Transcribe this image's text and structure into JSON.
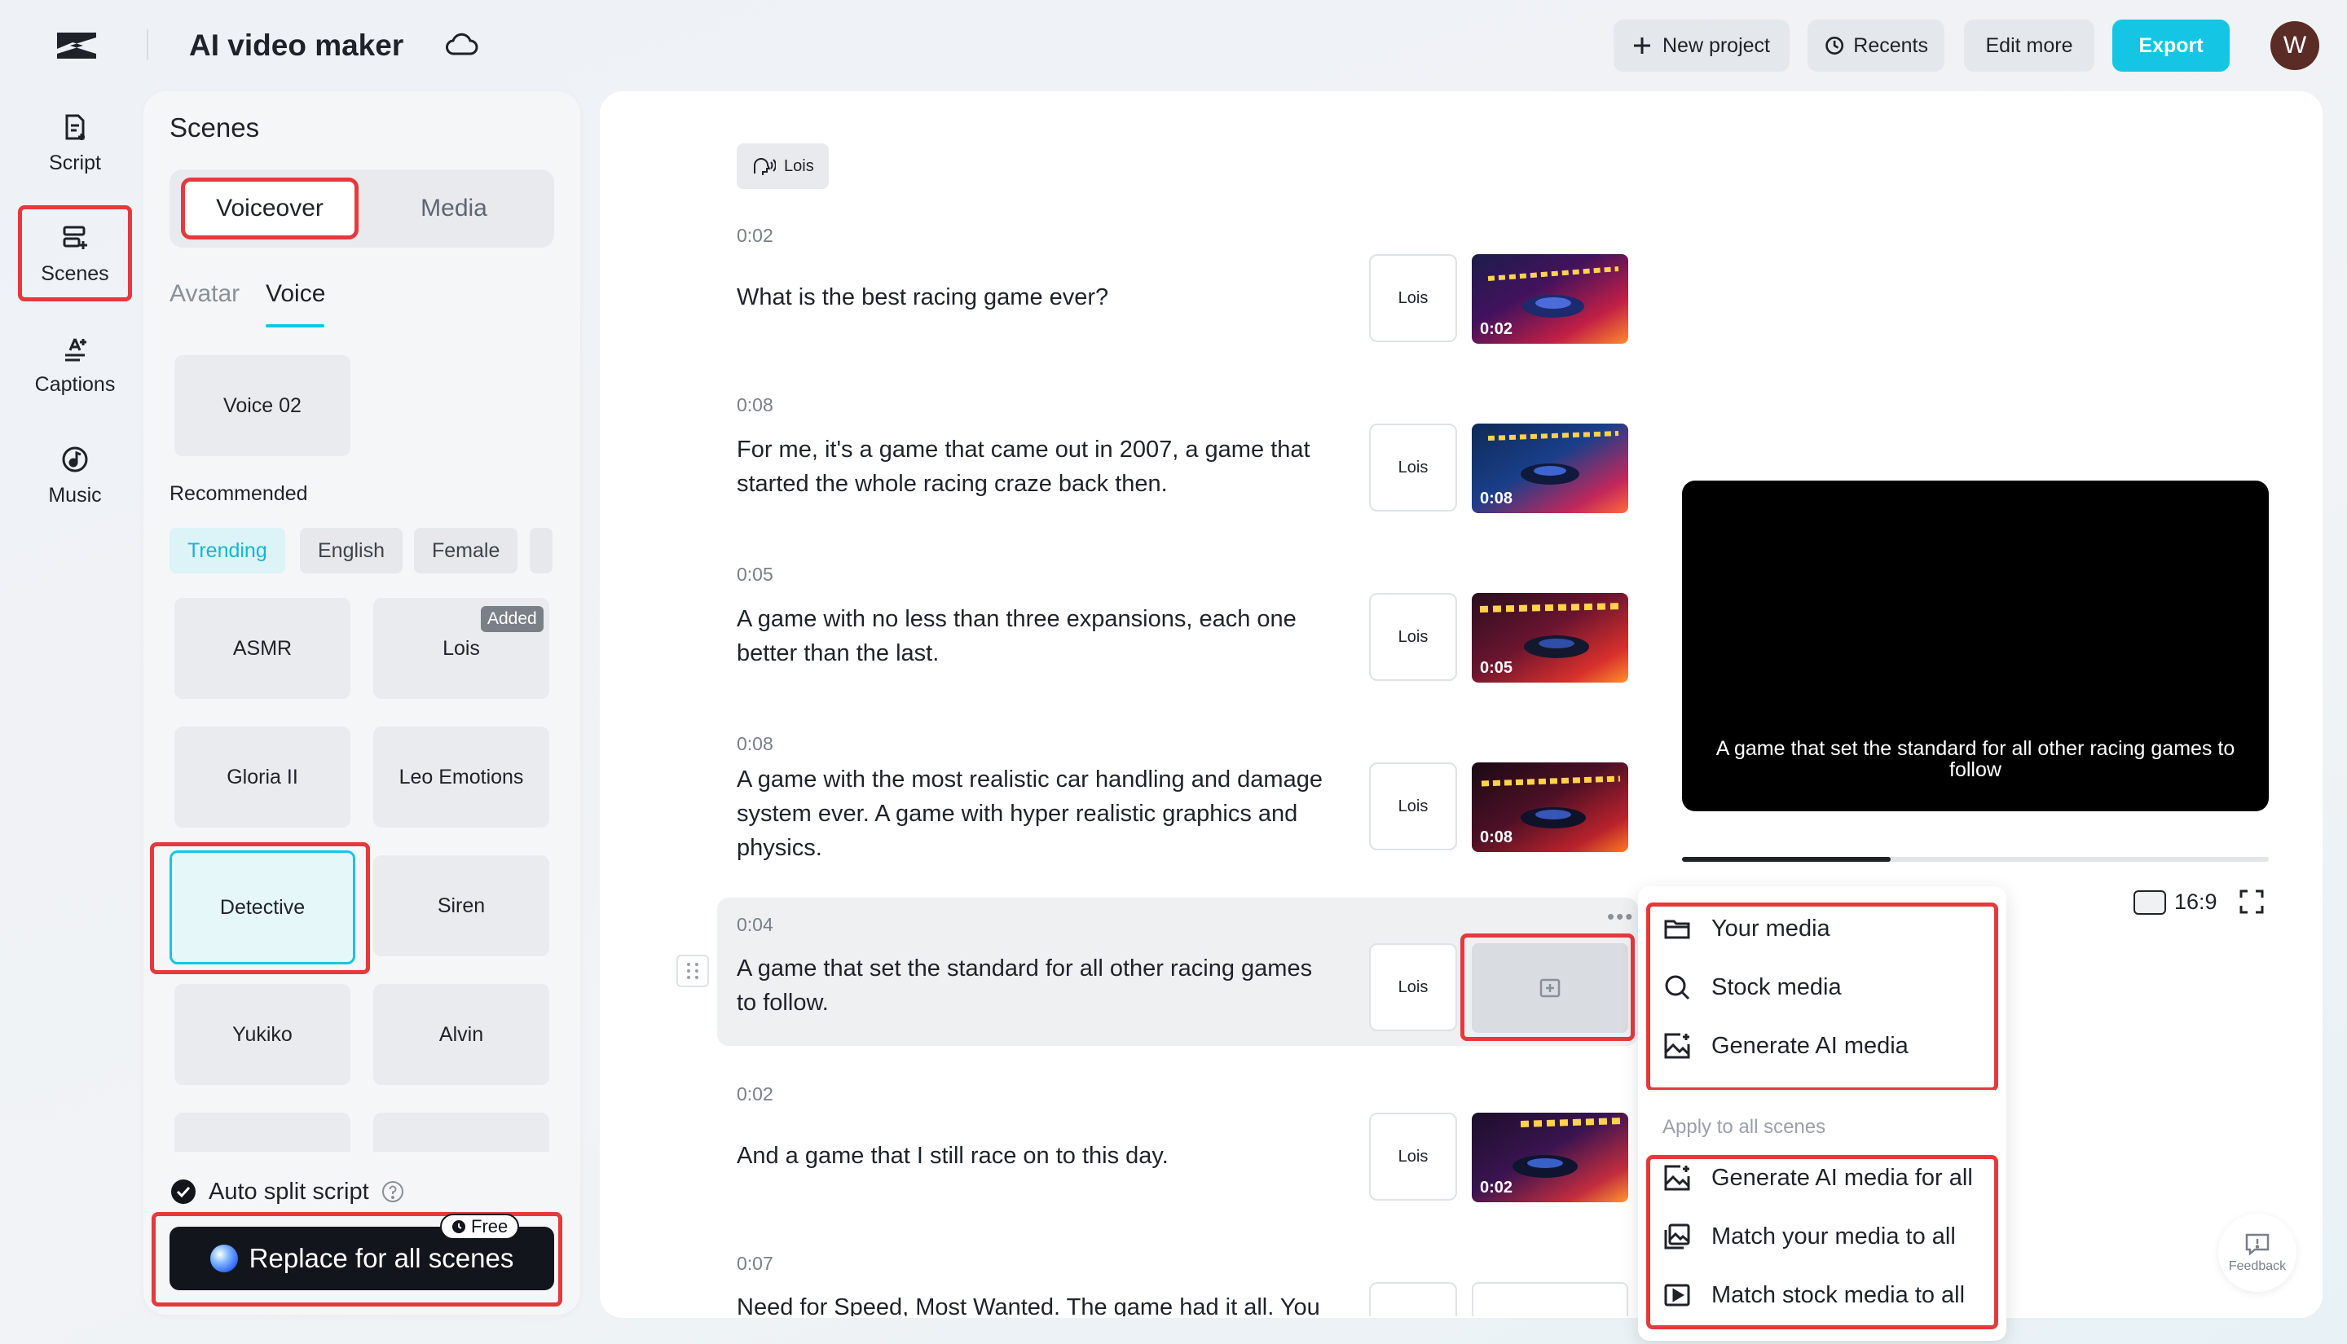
{
  "header": {
    "app_title": "AI video maker",
    "new_project": "New project",
    "recents": "Recents",
    "edit_more": "Edit more",
    "export": "Export",
    "avatar_initial": "W"
  },
  "rail": {
    "items": [
      {
        "label": "Script",
        "icon": "script-icon"
      },
      {
        "label": "Scenes",
        "icon": "scenes-icon"
      },
      {
        "label": "Captions",
        "icon": "captions-icon"
      },
      {
        "label": "Music",
        "icon": "music-icon"
      }
    ]
  },
  "scenes_panel": {
    "title": "Scenes",
    "tabs": [
      "Voiceover",
      "Media"
    ],
    "subtabs": [
      "Avatar",
      "Voice"
    ],
    "current_voice": "Voice 02",
    "recommended_label": "Recommended",
    "chips": [
      "Trending",
      "English",
      "Female"
    ],
    "voices": [
      "ASMR",
      "Lois",
      "Gloria II",
      "Leo Emotions",
      "Detective",
      "Siren",
      "Yukiko",
      "Alvin"
    ],
    "added_badge": "Added",
    "auto_split": "Auto split script",
    "replace_button": "Replace for all scenes",
    "free_badge": "Free"
  },
  "script": {
    "speaker": "Lois",
    "scenes": [
      {
        "time": "0:02",
        "text": "What is the best racing game ever?",
        "voice": "Lois",
        "thumb_time": "0:02"
      },
      {
        "time": "0:08",
        "text": "For me, it's a game that came out in 2007, a game that started the whole racing craze back then.",
        "voice": "Lois",
        "thumb_time": "0:08"
      },
      {
        "time": "0:05",
        "text": "A game with no less than three expansions, each one better than the last.",
        "voice": "Lois",
        "thumb_time": "0:05"
      },
      {
        "time": "0:08",
        "text": "A game with the most realistic car handling and damage system ever. A game with hyper realistic graphics and physics.",
        "voice": "Lois",
        "thumb_time": "0:08"
      },
      {
        "time": "0:04",
        "text": "A game that set the standard for all other racing games to follow.",
        "voice": "Lois",
        "thumb_time": ""
      },
      {
        "time": "0:02",
        "text": "And a game that I still race on to this day.",
        "voice": "Lois",
        "thumb_time": "0:02"
      },
      {
        "time": "0:07",
        "text": "Need for Speed, Most Wanted. The game had it all. You",
        "voice": "",
        "thumb_time": ""
      }
    ]
  },
  "preview": {
    "caption": "A game that set the standard for all other racing games to follow",
    "progress": 0.355,
    "aspect_ratio": "16:9"
  },
  "media_menu": {
    "items": [
      "Your media",
      "Stock media",
      "Generate AI media"
    ],
    "section_label": "Apply to all scenes",
    "apply_all_items": [
      "Generate AI media for all",
      "Match your media to all",
      "Match stock media to all"
    ]
  },
  "feedback_label": "Feedback"
}
